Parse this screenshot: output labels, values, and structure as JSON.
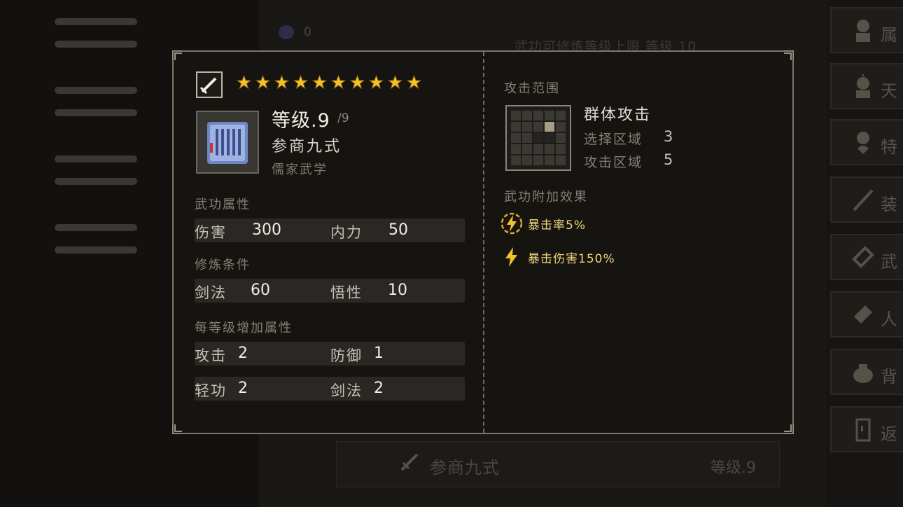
{
  "background": {
    "top_counter": "0",
    "top_text": "武功可修炼等级上限 等级 10",
    "bottom_bar": {
      "name": "参商九式",
      "level": "等级.9"
    },
    "right_tabs": [
      {
        "label": "属",
        "icon": "character-icon"
      },
      {
        "label": "天",
        "icon": "talent-icon"
      },
      {
        "label": "特",
        "icon": "trait-icon"
      },
      {
        "label": "装",
        "icon": "sword-icon"
      },
      {
        "label": "武",
        "icon": "book-icon"
      },
      {
        "label": "人",
        "icon": "scroll-icon"
      },
      {
        "label": "背",
        "icon": "bag-icon"
      },
      {
        "label": "返",
        "icon": "door-icon"
      }
    ]
  },
  "skill": {
    "weapon_icon": "sword-icon",
    "stars": 10,
    "star_color": "#f2c22a",
    "level_label": "等级.9",
    "level_max": "/9",
    "name": "参商九式",
    "school": "儒家武学",
    "attr_title": "武功属性",
    "attributes": [
      {
        "key": "伤害",
        "value": "300"
      },
      {
        "key": "内力",
        "value": "50"
      }
    ],
    "req_title": "修炼条件",
    "requirements": [
      {
        "key": "剑法",
        "value": "60"
      },
      {
        "key": "悟性",
        "value": "10"
      }
    ],
    "growth_title": "每等级增加属性",
    "growth": [
      {
        "key": "攻击",
        "value": "2"
      },
      {
        "key": "防御",
        "value": "1"
      },
      {
        "key": "轻功",
        "value": "2"
      },
      {
        "key": "剑法",
        "value": "2"
      }
    ],
    "range_title": "攻击范围",
    "range_name": "群体攻击",
    "range_rows": [
      {
        "key": "选择区域",
        "value": "3"
      },
      {
        "key": "攻击区域",
        "value": "5"
      }
    ],
    "effects_title": "武功附加效果",
    "effects": [
      {
        "icon": "lightning-circle-icon",
        "text": "暴击率5%"
      },
      {
        "icon": "lightning-icon",
        "text": "暴击伤害150%"
      }
    ]
  }
}
